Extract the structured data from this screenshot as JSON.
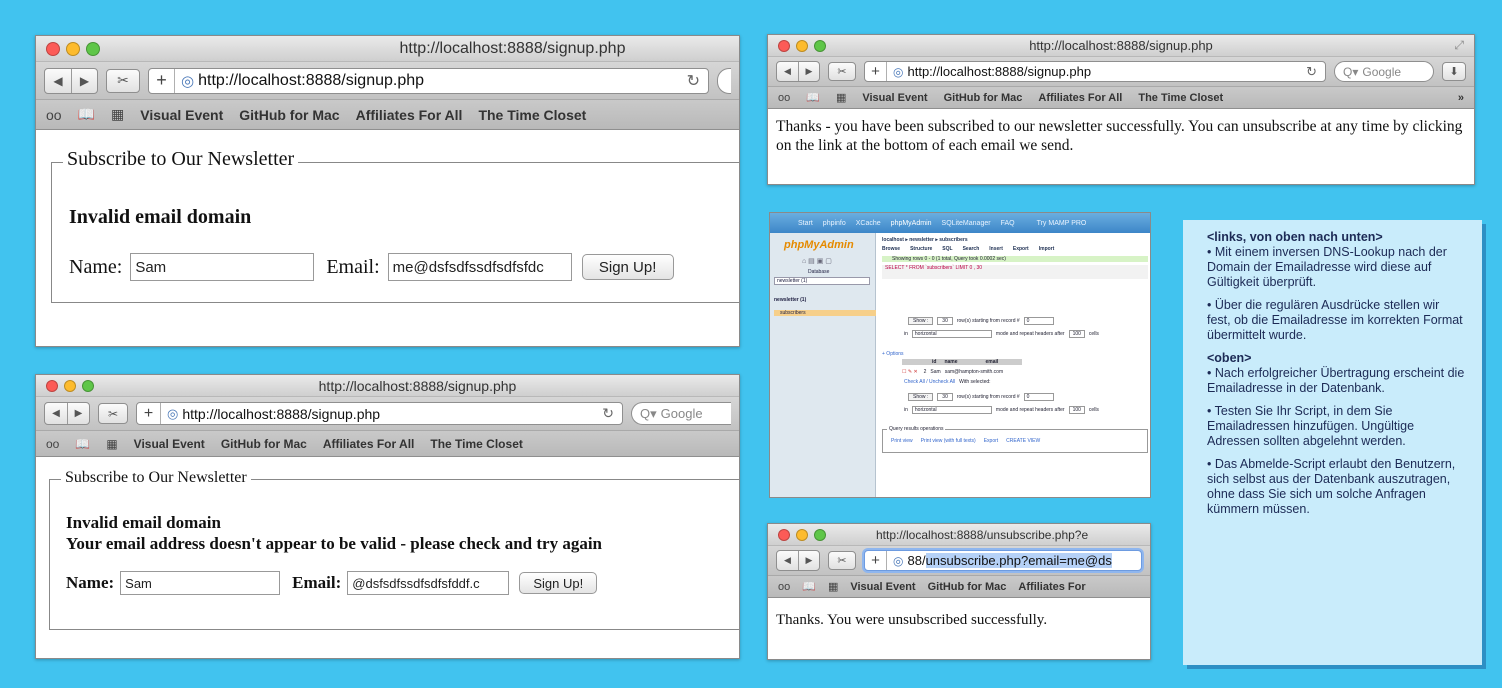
{
  "colors": {
    "background": "#41c3ef",
    "info_box": "#c9ecfb",
    "info_text": "#1c2a55"
  },
  "icons": [
    "back-icon",
    "forward-icon",
    "snip-icon",
    "plus-icon",
    "globe-icon",
    "reload-icon",
    "search-icon",
    "download-icon",
    "reader-glasses-icon",
    "book-icon",
    "grid-icon"
  ],
  "bookmarks": [
    "Visual Event",
    "GitHub for Mac",
    "Affiliates For All",
    "The Time Closet"
  ],
  "win1": {
    "title": "http://localhost:8888/signup.php",
    "url": "http://localhost:8888/signup.php",
    "legend": "Subscribe to Our Newsletter",
    "error": "Invalid email domain",
    "name_label": "Name:",
    "name_value": "Sam",
    "email_label": "Email:",
    "email_value": "me@dsfsdfssdfsdfsfdc",
    "button": "Sign Up!"
  },
  "win2": {
    "title": "http://localhost:8888/signup.php",
    "url": "http://localhost:8888/signup.php",
    "search_placeholder": "Google",
    "legend": "Subscribe to Our Newsletter",
    "error1": "Invalid email domain",
    "error2": "Your email address doesn't appear to be valid - please check and try again",
    "name_label": "Name:",
    "name_value": "Sam",
    "email_label": "Email:",
    "email_value": "@dsfsdfssdfsdfsfddf.c",
    "button": "Sign Up!"
  },
  "win3": {
    "title": "http://localhost:8888/signup.php",
    "url": "http://localhost:8888/signup.php",
    "search_placeholder": "Google",
    "message": "Thanks - you have been subscribed to our newsletter successfully. You can unsubscribe at any time by clicking on the link at the bottom of each email we send."
  },
  "win4": {
    "title": "http://localhost:8888/unsubscribe.php?e",
    "url_prefix": "88/",
    "url_highlight": "unsubscribe.php?email=me@ds",
    "message": "Thanks. You were unsubscribed successfully.",
    "bookmarks": [
      "Visual Event",
      "GitHub for Mac",
      "Affiliates For"
    ]
  },
  "pma": {
    "tabs": [
      "Start",
      "phpinfo",
      "XCache",
      "phpMyAdmin",
      "SQLiteManager",
      "FAQ",
      "Try MAMP PRO"
    ],
    "logo": "phpMyAdmin",
    "database_label": "Database",
    "db_select": "newsletter (1)",
    "db_name": "newsletter (1)",
    "table_name": "subscribers",
    "breadcrumb": "localhost ▸ newsletter ▸ subscribers",
    "actions": [
      "Browse",
      "Structure",
      "SQL",
      "Search",
      "Insert",
      "Export",
      "Import"
    ],
    "status": "Showing rows 0 - 0 (1 total, Query took 0.0002 sec)",
    "sql": "SELECT * FROM `subscribers` LIMIT 0 , 30",
    "show_btn": "Show :",
    "rows": "30",
    "start_label": "row(s) starting from record #",
    "start_value": "0",
    "in_label": "in",
    "mode": "horizontal",
    "mode_label": "mode and repeat headers after",
    "repeat": "100",
    "cells": "cells",
    "options": "+ Options",
    "columns": [
      "id",
      "name",
      "email"
    ],
    "row": [
      "2",
      "Sam",
      "sam@hampton-smith.com"
    ],
    "check_all": "Check All / Uncheck All",
    "with_selected": "With selected:",
    "query_ops": "Query results operations",
    "ops": [
      "Print view",
      "Print view (with full texts)",
      "Export",
      "CREATE VIEW"
    ]
  },
  "info": {
    "h1": "<links, von oben nach unten>",
    "p1": "• Mit einem inversen DNS-Lookup nach der Domain der Emailadresse wird diese auf Gültigkeit überprüft.",
    "p2": "• Über die regulären Ausdrücke stellen wir fest, ob die Emailadresse im korrekten Format übermittelt wurde.",
    "h2": "<oben>",
    "p3": "• Nach erfolgreicher Übertragung erscheint die Emailadresse in der Datenbank.",
    "p4": "• Testen Sie Ihr Script, in dem Sie Emailadressen hinzufügen. Ungültige Adressen sollten abgelehnt werden.",
    "p5": "• Das Abmelde-Script erlaubt den Benutzern, sich selbst aus der Datenbank auszutragen, ohne dass Sie sich um solche Anfragen kümmern müssen."
  }
}
